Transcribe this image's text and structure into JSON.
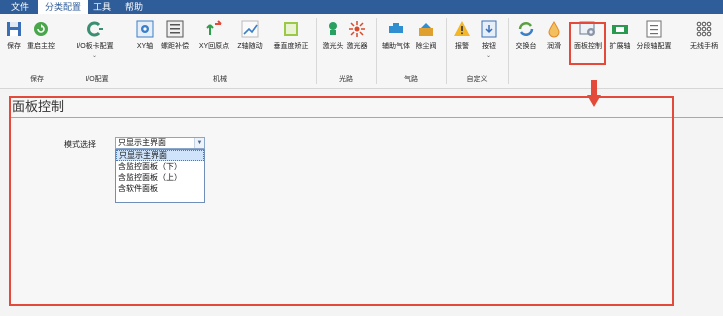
{
  "menubar": {
    "items": [
      {
        "label": "文件"
      },
      {
        "label": "分类配置"
      },
      {
        "label": "工具"
      },
      {
        "label": "帮助"
      }
    ]
  },
  "ribbon": {
    "tools": [
      {
        "label": "保存",
        "icon": "save-icon",
        "color": "#3a6fb7"
      },
      {
        "label": "重启主控",
        "icon": "restart-icon",
        "color": "#4aa64a"
      },
      {
        "label": "I/O板卡配置",
        "icon": "io-card-icon",
        "color": "#3a8f70"
      },
      {
        "label": "XY轴",
        "icon": "xy-axis-icon",
        "color": "#3a7fc8"
      },
      {
        "label": "螺距补偿",
        "icon": "pitch-comp-icon",
        "color": "#555555"
      },
      {
        "label": "XY回原点",
        "icon": "xy-home-icon",
        "color": "#2f9e4a"
      },
      {
        "label": "Z轴随动",
        "icon": "z-follow-icon",
        "color": "#3a7fc8"
      },
      {
        "label": "垂直度矫正",
        "icon": "vertical-correct-icon",
        "color": "#7aaa2a"
      },
      {
        "label": "激光头",
        "icon": "laser-head-icon",
        "color": "#2aa060"
      },
      {
        "label": "激光器",
        "icon": "laser-icon",
        "color": "#d84a2a"
      },
      {
        "label": "辅助气体",
        "icon": "aux-gas-icon",
        "color": "#2f8fd0"
      },
      {
        "label": "除尘阀",
        "icon": "dust-valve-icon",
        "color": "#2f8fd0"
      },
      {
        "label": "报警",
        "icon": "alarm-icon",
        "color": "#e0a020"
      },
      {
        "label": "按钮",
        "icon": "button-icon",
        "color": "#3a6fb7"
      },
      {
        "label": "交换台",
        "icon": "exchange-table-icon",
        "color": "#5aa040"
      },
      {
        "label": "润滑",
        "icon": "lubricate-icon",
        "color": "#e08a2a"
      },
      {
        "label": "面板控制",
        "icon": "panel-control-icon",
        "color": "#6a7a90"
      },
      {
        "label": "扩展轴",
        "icon": "extend-axis-icon",
        "color": "#2a9a50"
      },
      {
        "label": "分段轴配置",
        "icon": "segment-axis-icon",
        "color": "#707070"
      },
      {
        "label": "无线手柄",
        "icon": "wireless-handle-icon",
        "color": "#555555"
      }
    ],
    "groups": [
      {
        "label": "保存"
      },
      {
        "label": "I/O配置"
      },
      {
        "label": "机械"
      },
      {
        "label": "光路"
      },
      {
        "label": "气路"
      },
      {
        "label": "自定义"
      }
    ]
  },
  "panel": {
    "title": "面板控制",
    "mode_label": "模式选择",
    "mode_select": {
      "value": "只显示主界面",
      "options": [
        "只显示主界面",
        "含监控面板（下）",
        "含监控面板（上）",
        "含软件面板"
      ]
    }
  },
  "colors": {
    "menubar": "#2f5d9a",
    "highlight": "#e34a3a",
    "title_line": "#8fc06a",
    "selected_option": "#cfe3fb"
  }
}
